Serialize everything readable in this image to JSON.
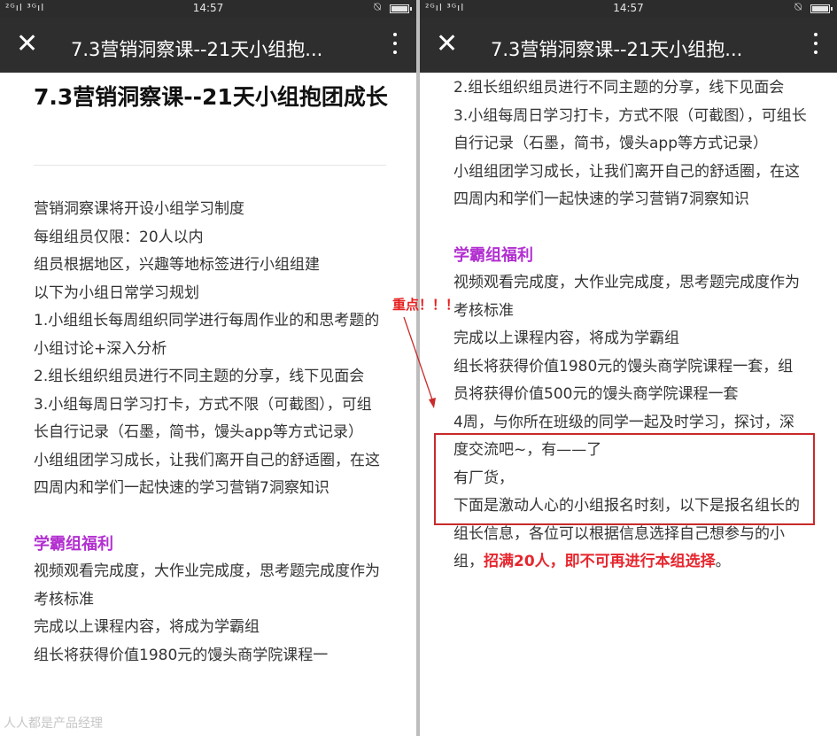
{
  "status": {
    "signal": "²ᴳıl ³ᴳıl",
    "time": "14:57"
  },
  "nav": {
    "title": "7.3营销洞察课--21天小组抱..."
  },
  "article": {
    "title": "7.3营销洞察课--21天小组抱团成长"
  },
  "lines": {
    "intro": "营销洞察课将开设小组学习制度",
    "limit": "每组组员仅限：20人以内",
    "grouping": "组员根据地区，兴趣等地标签进行小组组建",
    "plan": "以下为小组日常学习规划",
    "p1": "1.小组组长每周组织同学进行每周作业的和思考题的小组讨论+深入分析",
    "p2": "2.组长组织组员进行不同主题的分享，线下见面会",
    "p3": "3.小组每周日学习打卡，方式不限（可截图），可组长自行记录（石墨，简书，馒头app等方式记录）",
    "growth": "小组组团学习成长，让我们离开自己的舒适圈，在这四周内和学们一起快速的学习营销7洞察知识",
    "welfare_heading": "学霸组福利",
    "w1": "视频观看完成度，大作业完成度，思考题完成度作为考核标准",
    "w2": "完成以上课程内容，将成为学霸组",
    "w3": "组长将获得价值1980元的馒头商学院课程一套，组员将获得价值500元的馒头商学院课程一套",
    "w4": "4周，与你所在班级的同学一起及时学习，探讨，深度交流吧~，有——了",
    "w5": "有厂货，",
    "w6": "下面是激动人心的小组报名时刻，以下是报名组长的组长信息，各位可以根据信息选择自己想参与的小组，",
    "w6_highlight": "招满20人，即不可再进行本组选择",
    "w6_end": "。",
    "left_cut": "组长将获得价值1980元的馒头商学院课程一"
  },
  "annotation": {
    "text": "重点！！！",
    "color": "#e62020"
  },
  "watermark": "人人都是产品经理",
  "colors": {
    "heading_purple": "#b22fd0",
    "highlight_red": "#e6262e",
    "navbar": "#2e2e2e"
  }
}
